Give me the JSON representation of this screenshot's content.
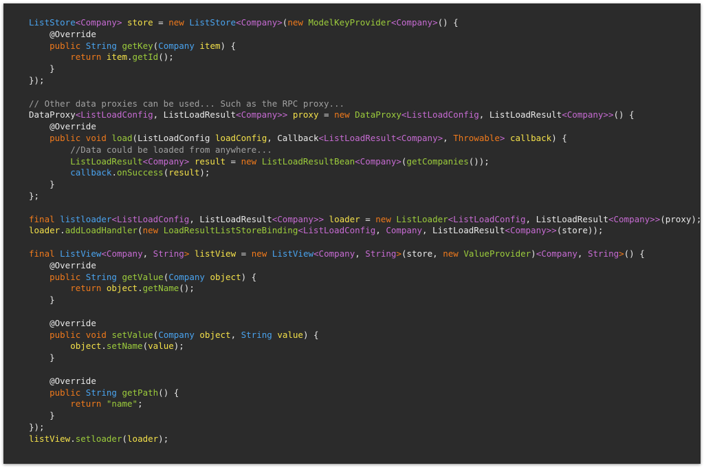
{
  "code": {
    "lines": [
      [
        [
          "ty",
          "ListStore"
        ],
        [
          "tp",
          "<Company>"
        ],
        [
          "pl",
          " "
        ],
        [
          "va",
          "store"
        ],
        [
          "pl",
          " = "
        ],
        [
          "kw",
          "new"
        ],
        [
          "pl",
          " "
        ],
        [
          "ty",
          "ListStore"
        ],
        [
          "tp",
          "<Company>"
        ],
        [
          "pl",
          "("
        ],
        [
          "kw",
          "new"
        ],
        [
          "pl",
          " "
        ],
        [
          "fn",
          "ModelKeyProvider"
        ],
        [
          "tp",
          "<Company>"
        ],
        [
          "pl",
          "() {"
        ]
      ],
      [
        [
          "pl",
          "    "
        ],
        [
          "an",
          "@Override"
        ]
      ],
      [
        [
          "pl",
          "    "
        ],
        [
          "kw",
          "public"
        ],
        [
          "pl",
          " "
        ],
        [
          "ty",
          "String"
        ],
        [
          "pl",
          " "
        ],
        [
          "fn",
          "getKey"
        ],
        [
          "pl",
          "("
        ],
        [
          "ty",
          "Company"
        ],
        [
          "pl",
          " "
        ],
        [
          "va",
          "item"
        ],
        [
          "pl",
          ") {"
        ]
      ],
      [
        [
          "pl",
          "        "
        ],
        [
          "kw",
          "return"
        ],
        [
          "pl",
          " "
        ],
        [
          "va",
          "item"
        ],
        [
          "pl",
          "."
        ],
        [
          "fn",
          "getId"
        ],
        [
          "pl",
          "();"
        ]
      ],
      [
        [
          "pl",
          "    }"
        ]
      ],
      [
        [
          "pl",
          "});"
        ]
      ],
      [
        [
          "pl",
          ""
        ]
      ],
      [
        [
          "co",
          "// Other data proxies can be used... Such as the RPC proxy..."
        ]
      ],
      [
        [
          "pl",
          "DataProxy"
        ],
        [
          "tp",
          "<ListLoadConfig"
        ],
        [
          "pl",
          ", ListLoadResult"
        ],
        [
          "tp",
          "<Company>>"
        ],
        [
          "pl",
          " "
        ],
        [
          "va",
          "proxy"
        ],
        [
          "pl",
          " = "
        ],
        [
          "kw",
          "new"
        ],
        [
          "pl",
          " "
        ],
        [
          "fn",
          "DataProxy"
        ],
        [
          "tp",
          "<ListLoadConfig"
        ],
        [
          "pl",
          ", ListLoadResult"
        ],
        [
          "tp",
          "<Company>>"
        ],
        [
          "pl",
          "() {"
        ]
      ],
      [
        [
          "pl",
          "    "
        ],
        [
          "an",
          "@Override"
        ]
      ],
      [
        [
          "pl",
          "    "
        ],
        [
          "kw",
          "public void"
        ],
        [
          "pl",
          " "
        ],
        [
          "fn",
          "load"
        ],
        [
          "pl",
          "(ListLoadConfig "
        ],
        [
          "va",
          "loadConfig"
        ],
        [
          "pl",
          ", Callback"
        ],
        [
          "tp",
          "<ListLoadResult<Company>"
        ],
        [
          "pl",
          ", "
        ],
        [
          "kw",
          "Throwable"
        ],
        [
          "tp",
          ">"
        ],
        [
          "pl",
          " "
        ],
        [
          "va",
          "callback"
        ],
        [
          "pl",
          ") {"
        ]
      ],
      [
        [
          "pl",
          "        "
        ],
        [
          "co",
          "//Data could be loaded from anywhere..."
        ]
      ],
      [
        [
          "pl",
          "        "
        ],
        [
          "fn",
          "ListLoadResult"
        ],
        [
          "tp",
          "<Company>"
        ],
        [
          "pl",
          " "
        ],
        [
          "va",
          "result"
        ],
        [
          "pl",
          " = "
        ],
        [
          "kw",
          "new"
        ],
        [
          "pl",
          " "
        ],
        [
          "fn",
          "ListLoadResultBean"
        ],
        [
          "tp",
          "<Company>"
        ],
        [
          "pl",
          "("
        ],
        [
          "fn",
          "getCompanies"
        ],
        [
          "pl",
          "());"
        ]
      ],
      [
        [
          "pl",
          "        "
        ],
        [
          "ty",
          "callback"
        ],
        [
          "pl",
          "."
        ],
        [
          "fn",
          "onSuccess"
        ],
        [
          "pl",
          "("
        ],
        [
          "va",
          "result"
        ],
        [
          "pl",
          ");"
        ]
      ],
      [
        [
          "pl",
          "    }"
        ]
      ],
      [
        [
          "pl",
          "};"
        ]
      ],
      [
        [
          "pl",
          ""
        ]
      ],
      [
        [
          "kw",
          "final"
        ],
        [
          "pl",
          " "
        ],
        [
          "ty",
          "listloader"
        ],
        [
          "tp",
          "<ListLoadConfig"
        ],
        [
          "pl",
          ", ListLoadResult"
        ],
        [
          "tp",
          "<Company>>"
        ],
        [
          "pl",
          " "
        ],
        [
          "va",
          "loader"
        ],
        [
          "pl",
          " = "
        ],
        [
          "kw",
          "new"
        ],
        [
          "pl",
          " "
        ],
        [
          "fn",
          "ListLoader"
        ],
        [
          "tp",
          "<ListLoadConfig"
        ],
        [
          "pl",
          ", ListLoadResult"
        ],
        [
          "tp",
          "<Company>>"
        ],
        [
          "pl",
          "(proxy);"
        ]
      ],
      [
        [
          "va",
          "loader"
        ],
        [
          "pl",
          "."
        ],
        [
          "fn",
          "addLoadHandler"
        ],
        [
          "pl",
          "("
        ],
        [
          "kw",
          "new"
        ],
        [
          "pl",
          " "
        ],
        [
          "fn",
          "LoadResultListStoreBinding"
        ],
        [
          "tp",
          "<ListLoadConfig"
        ],
        [
          "pl",
          ", "
        ],
        [
          "tp",
          "Company"
        ],
        [
          "pl",
          ", ListLoadResult"
        ],
        [
          "tp",
          "<Company>>"
        ],
        [
          "pl",
          "(store));"
        ]
      ],
      [
        [
          "pl",
          ""
        ]
      ],
      [
        [
          "kw",
          "final"
        ],
        [
          "pl",
          " "
        ],
        [
          "ty",
          "ListView"
        ],
        [
          "tp",
          "<Company"
        ],
        [
          "pl",
          ", "
        ],
        [
          "tp",
          "String"
        ],
        [
          "kw",
          ">"
        ],
        [
          "pl",
          " "
        ],
        [
          "va",
          "listView"
        ],
        [
          "pl",
          " = "
        ],
        [
          "kw",
          "new"
        ],
        [
          "pl",
          " "
        ],
        [
          "ty",
          "ListView"
        ],
        [
          "tp",
          "<Company"
        ],
        [
          "pl",
          ", "
        ],
        [
          "tp",
          "String"
        ],
        [
          "kw",
          ">"
        ],
        [
          "pl",
          "(store, "
        ],
        [
          "kw",
          "new"
        ],
        [
          "pl",
          " "
        ],
        [
          "fn",
          "ValueProvider"
        ],
        [
          "pl",
          ")"
        ],
        [
          "tp",
          "<Company"
        ],
        [
          "pl",
          ", "
        ],
        [
          "tp",
          "String"
        ],
        [
          "kw",
          ">"
        ],
        [
          "pl",
          "() {"
        ]
      ],
      [
        [
          "pl",
          "    "
        ],
        [
          "an",
          "@Override"
        ]
      ],
      [
        [
          "pl",
          "    "
        ],
        [
          "kw",
          "public"
        ],
        [
          "pl",
          " "
        ],
        [
          "ty",
          "String"
        ],
        [
          "pl",
          " "
        ],
        [
          "fn",
          "getValue"
        ],
        [
          "pl",
          "("
        ],
        [
          "ty",
          "Company"
        ],
        [
          "pl",
          " "
        ],
        [
          "va",
          "object"
        ],
        [
          "pl",
          ") {"
        ]
      ],
      [
        [
          "pl",
          "        "
        ],
        [
          "kw",
          "return"
        ],
        [
          "pl",
          " "
        ],
        [
          "va",
          "object"
        ],
        [
          "pl",
          "."
        ],
        [
          "fn",
          "getName"
        ],
        [
          "pl",
          "();"
        ]
      ],
      [
        [
          "pl",
          "    }"
        ]
      ],
      [
        [
          "pl",
          ""
        ]
      ],
      [
        [
          "pl",
          "    "
        ],
        [
          "an",
          "@Override"
        ]
      ],
      [
        [
          "pl",
          "    "
        ],
        [
          "kw",
          "public void"
        ],
        [
          "pl",
          " "
        ],
        [
          "fn",
          "setValue"
        ],
        [
          "pl",
          "("
        ],
        [
          "ty",
          "Company"
        ],
        [
          "pl",
          " "
        ],
        [
          "va",
          "object"
        ],
        [
          "pl",
          ", "
        ],
        [
          "ty",
          "String"
        ],
        [
          "pl",
          " "
        ],
        [
          "va",
          "value"
        ],
        [
          "pl",
          ") {"
        ]
      ],
      [
        [
          "pl",
          "        "
        ],
        [
          "va",
          "object"
        ],
        [
          "pl",
          "."
        ],
        [
          "fn",
          "setName"
        ],
        [
          "pl",
          "("
        ],
        [
          "va",
          "value"
        ],
        [
          "pl",
          ");"
        ]
      ],
      [
        [
          "pl",
          "    }"
        ]
      ],
      [
        [
          "pl",
          ""
        ]
      ],
      [
        [
          "pl",
          "    "
        ],
        [
          "an",
          "@Override"
        ]
      ],
      [
        [
          "pl",
          "    "
        ],
        [
          "kw",
          "public"
        ],
        [
          "pl",
          " "
        ],
        [
          "ty",
          "String"
        ],
        [
          "pl",
          " "
        ],
        [
          "fn",
          "getPath"
        ],
        [
          "pl",
          "() {"
        ]
      ],
      [
        [
          "pl",
          "        "
        ],
        [
          "kw",
          "return"
        ],
        [
          "pl",
          " "
        ],
        [
          "st",
          "\"name\""
        ],
        [
          "pl",
          ";"
        ]
      ],
      [
        [
          "pl",
          "    }"
        ]
      ],
      [
        [
          "pl",
          "});"
        ]
      ],
      [
        [
          "va",
          "listView"
        ],
        [
          "pl",
          "."
        ],
        [
          "fn",
          "setloader"
        ],
        [
          "pl",
          "("
        ],
        [
          "va",
          "loader"
        ],
        [
          "pl",
          ");"
        ]
      ]
    ]
  },
  "colors": {
    "background": "#2b2b2b",
    "keyword": "#f07a1c",
    "type": "#4aa3ee",
    "type_param": "#c66bd2",
    "function": "#9ccc3c",
    "variable": "#f3e04a",
    "comment": "#a0a0a0",
    "plain": "#e8e8e8"
  }
}
